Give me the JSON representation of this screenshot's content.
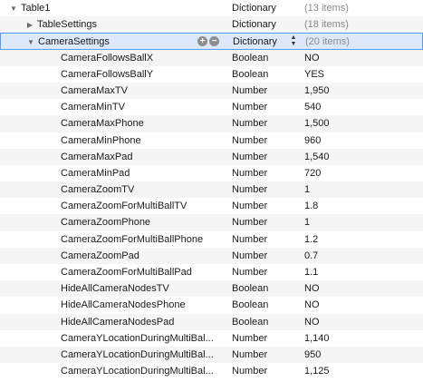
{
  "plist": {
    "root": {
      "key": "Table1",
      "type": "Dictionary",
      "value": "(13 items)"
    },
    "table_settings": {
      "key": "TableSettings",
      "type": "Dictionary",
      "value": "(18 items)"
    },
    "camera_settings": {
      "key": "CameraSettings",
      "type": "Dictionary",
      "value": "(20 items)"
    },
    "children": [
      {
        "key": "CameraFollowsBallX",
        "type": "Boolean",
        "value": "NO"
      },
      {
        "key": "CameraFollowsBallY",
        "type": "Boolean",
        "value": "YES"
      },
      {
        "key": "CameraMaxTV",
        "type": "Number",
        "value": "1,950"
      },
      {
        "key": "CameraMinTV",
        "type": "Number",
        "value": "540"
      },
      {
        "key": "CameraMaxPhone",
        "type": "Number",
        "value": "1,500"
      },
      {
        "key": "CameraMinPhone",
        "type": "Number",
        "value": "960"
      },
      {
        "key": "CameraMaxPad",
        "type": "Number",
        "value": "1,540"
      },
      {
        "key": "CameraMinPad",
        "type": "Number",
        "value": "720"
      },
      {
        "key": "CameraZoomTV",
        "type": "Number",
        "value": "1"
      },
      {
        "key": "CameraZoomForMultiBallTV",
        "type": "Number",
        "value": "1.8"
      },
      {
        "key": "CameraZoomPhone",
        "type": "Number",
        "value": "1"
      },
      {
        "key": "CameraZoomForMultiBallPhone",
        "type": "Number",
        "value": "1.2"
      },
      {
        "key": "CameraZoomPad",
        "type": "Number",
        "value": "0.7"
      },
      {
        "key": "CameraZoomForMultiBallPad",
        "type": "Number",
        "value": "1.1"
      },
      {
        "key": "HideAllCameraNodesTV",
        "type": "Boolean",
        "value": "NO"
      },
      {
        "key": "HideAllCameraNodesPhone",
        "type": "Boolean",
        "value": "NO"
      },
      {
        "key": "HideAllCameraNodesPad",
        "type": "Boolean",
        "value": "NO"
      },
      {
        "key": "CameraYLocationDuringMultiBal...",
        "type": "Number",
        "value": "1,140"
      },
      {
        "key": "CameraYLocationDuringMultiBal...",
        "type": "Number",
        "value": "950"
      },
      {
        "key": "CameraYLocationDuringMultiBal...",
        "type": "Number",
        "value": "1,125"
      }
    ]
  },
  "icons": {
    "expanded": "disclosure-triangle-expanded-icon",
    "collapsed": "disclosure-triangle-collapsed-icon",
    "add": "add-row-icon",
    "remove": "remove-row-icon",
    "stepper": "type-stepper-icon"
  },
  "colors": {
    "selection_fill": "#dbe9fb",
    "selection_border": "#5d9cec",
    "alt_row": "#f5f5f5",
    "muted_text": "#8a8a8a"
  }
}
